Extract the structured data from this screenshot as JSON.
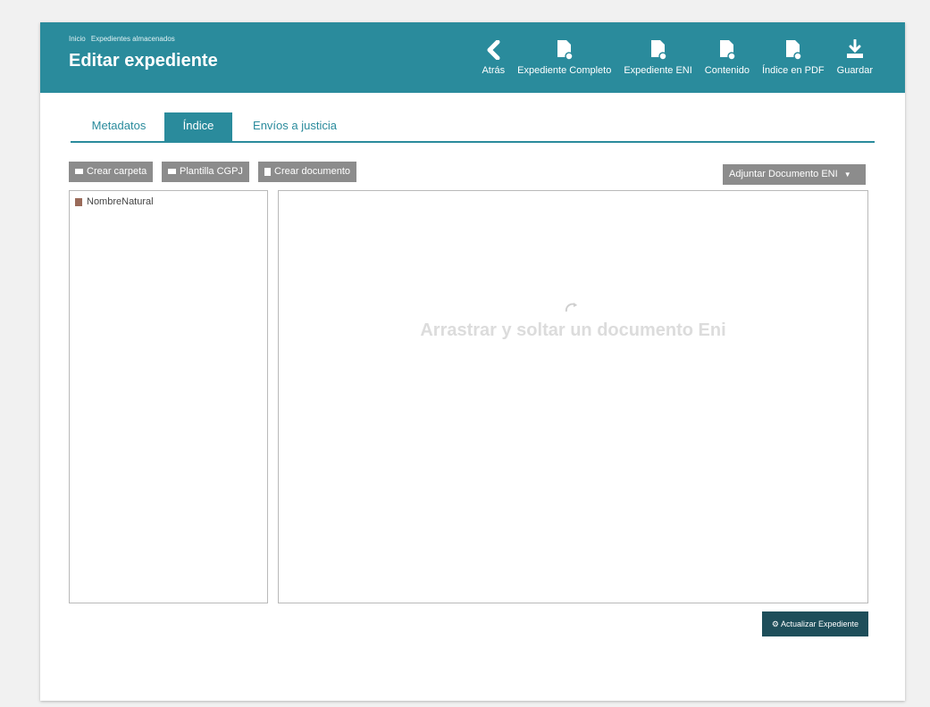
{
  "header": {
    "breadcrumb": [
      "Inicio",
      "Expedientes almacenados"
    ],
    "title": "Editar expediente"
  },
  "toolbar": {
    "items": [
      {
        "label": "Atrás",
        "icon": "chevron-left-icon"
      },
      {
        "label": "Expediente Completo",
        "icon": "document-download-icon"
      },
      {
        "label": "Expediente ENI",
        "icon": "document-download-icon"
      },
      {
        "label": "Contenido",
        "icon": "document-download-icon"
      },
      {
        "label": "Índice en PDF",
        "icon": "document-download-icon"
      },
      {
        "label": "Guardar",
        "icon": "save-download-icon"
      }
    ]
  },
  "tabs": [
    {
      "label": "Metadatos",
      "active": false
    },
    {
      "label": "Índice",
      "active": true
    },
    {
      "label": "Envíos a justicia",
      "active": false
    }
  ],
  "actions": {
    "crear_carpeta": "Crear carpeta",
    "plantilla_cgpj": "Plantilla CGPJ",
    "crear_documento": "Crear documento",
    "adjuntar": "Adjuntar Documento ENI",
    "actualizar": "Actualizar Expediente"
  },
  "tree": {
    "items": [
      "NombreNatural"
    ]
  },
  "dropzone": {
    "text": "Arrastrar y soltar un documento Eni"
  },
  "colors": {
    "accent": "#2a8b9c",
    "button_grey": "#8c8c8c",
    "button_dark": "#1e4e5a"
  }
}
